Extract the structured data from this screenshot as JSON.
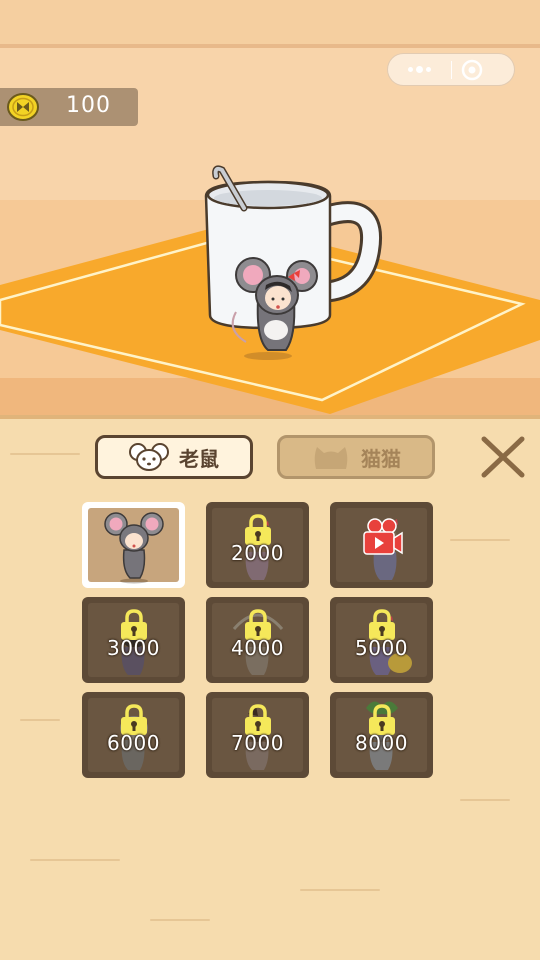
{
  "top_bar": {
    "coins": "100",
    "more_icon": "more-dots-icon",
    "target_icon": "target-icon",
    "coin_icon": "coin-icon"
  },
  "scene": {
    "mug_color": "#f5f7f9",
    "placemat_color": "#f8a92c"
  },
  "tabs": [
    {
      "label": "老鼠",
      "icon": "mouse-head-icon",
      "selected": true
    },
    {
      "label": "猫猫",
      "icon": "cat-head-icon",
      "selected": false
    }
  ],
  "close_icon": "close-x-icon",
  "skins": [
    {
      "id": "mouse-default",
      "price": "",
      "state": "selected"
    },
    {
      "id": "skin-2",
      "price": "2000",
      "state": "locked"
    },
    {
      "id": "skin-3",
      "price": "",
      "state": "video"
    },
    {
      "id": "skin-4",
      "price": "3000",
      "state": "locked"
    },
    {
      "id": "skin-5",
      "price": "4000",
      "state": "locked"
    },
    {
      "id": "skin-6",
      "price": "5000",
      "state": "locked"
    },
    {
      "id": "skin-7",
      "price": "6000",
      "state": "locked"
    },
    {
      "id": "skin-8",
      "price": "7000",
      "state": "locked"
    },
    {
      "id": "skin-9",
      "price": "8000",
      "state": "locked"
    }
  ],
  "colors": {
    "accent_dark": "#5a4430",
    "lock_yellow": "#f5e85a",
    "video_red": "#e8413c",
    "panel_bg": "#f6dcae"
  }
}
